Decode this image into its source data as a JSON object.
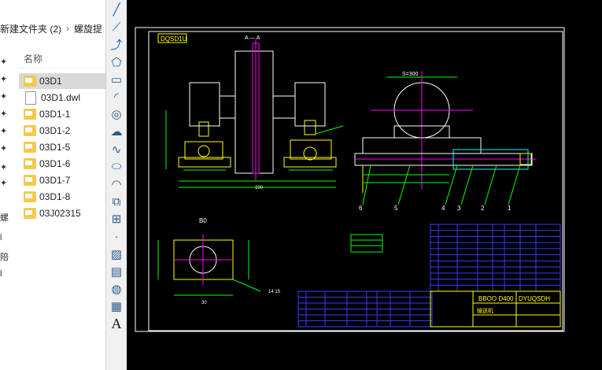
{
  "explorer": {
    "breadcrumb": [
      "新建文件夹 (2)",
      "螺旋提"
    ],
    "breadcrumb_sep": "›",
    "column_header": "名称",
    "left_marks": [
      "螺",
      "l",
      "陪",
      "l"
    ],
    "files": [
      {
        "name": "03D1",
        "type": "dwg",
        "selected": true
      },
      {
        "name": "03D1.dwl",
        "type": "dwl",
        "selected": false
      },
      {
        "name": "03D1-1",
        "type": "dwg",
        "selected": false
      },
      {
        "name": "03D1-2",
        "type": "dwg",
        "selected": false
      },
      {
        "name": "03D1-5",
        "type": "dwg",
        "selected": false
      },
      {
        "name": "03D1-6",
        "type": "dwg",
        "selected": false
      },
      {
        "name": "03D1-7",
        "type": "dwg",
        "selected": false
      },
      {
        "name": "03D1-8",
        "type": "dwg",
        "selected": false
      },
      {
        "name": "03J02315",
        "type": "dwg",
        "selected": false
      }
    ]
  },
  "toolbar": {
    "tools": [
      "line-icon",
      "construction-line-icon",
      "polyline-icon",
      "polygon-icon",
      "rectangle-icon",
      "arc-icon",
      "circle-icon",
      "revision-cloud-icon",
      "spline-icon",
      "ellipse-icon",
      "ellipse-arc-icon",
      "insert-block-icon",
      "make-block-icon",
      "point-icon",
      "hatch-icon",
      "gradient-icon",
      "region-icon",
      "table-icon",
      "multiline-text-icon"
    ],
    "text_tool_label": "A"
  },
  "drawing": {
    "code": "DQSD1U",
    "section_label": "A — A",
    "dim_s": "S=300",
    "label_b": "B0",
    "dim_100": "100",
    "dim_30": "30",
    "dim_14": "14 15",
    "title_spec": "BBOO D400",
    "title_code": "DYUQSDH",
    "title_name": "输送机",
    "balloons": [
      "6",
      "5",
      "4",
      "3",
      "2",
      "1"
    ],
    "colors": {
      "frame": "#ffffff",
      "part": "#ffff00",
      "dim": "#00ff00",
      "center": "#ff00ff",
      "table": "#3a3aff",
      "pipe": "#00ffff"
    }
  }
}
